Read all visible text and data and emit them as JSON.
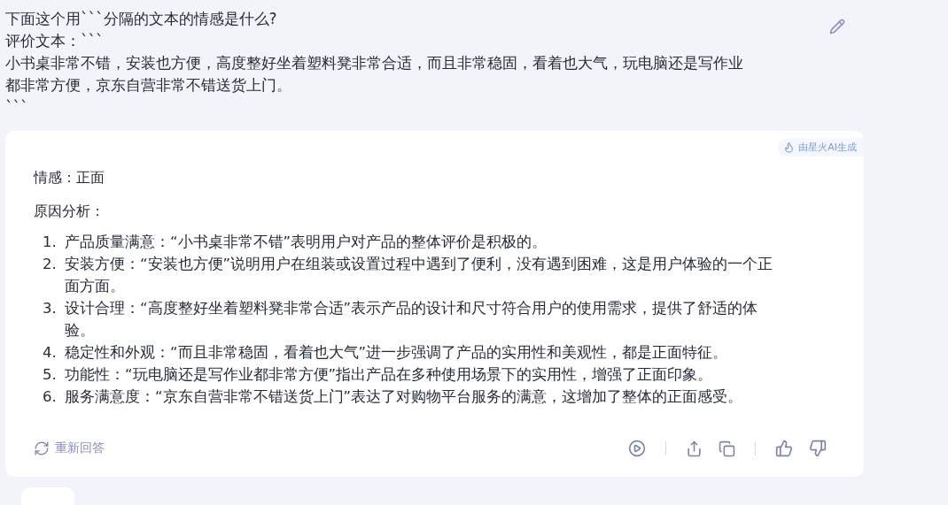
{
  "question": {
    "lines": [
      "下面这个用```分隔的文本的情感是什么?",
      "评价文本：```",
      "小书桌非常不错，安装也方便，高度整好坐着塑料凳非常合适，而且非常稳固，看着也大气，玩电脑还是写作业",
      "都非常方便，京东自营非常不错送货上门。",
      "```"
    ]
  },
  "answer": {
    "badge": "由星火AI生成",
    "sentiment": "情感：正面",
    "analysis_title": "原因分析：",
    "reasons": [
      {
        "number": "1.",
        "lines": [
          "产品质量满意：“小书桌非常不错”表明用户对产品的整体评价是积极的。"
        ]
      },
      {
        "number": "2.",
        "lines": [
          "安装方便：“安装也方便”说明用户在组装或设置过程中遇到了便利，没有遇到困难，这是用户体验的一个正",
          "面方面。"
        ]
      },
      {
        "number": "3.",
        "lines": [
          "设计合理：“高度整好坐着塑料凳非常合适”表示产品的设计和尺寸符合用户的使用需求，提供了舒适的体",
          "验。"
        ]
      },
      {
        "number": "4.",
        "lines": [
          "稳定性和外观：“而且非常稳固，看着也大气”进一步强调了产品的实用性和美观性，都是正面特征。"
        ]
      },
      {
        "number": "5.",
        "lines": [
          "功能性：“玩电脑还是写作业都非常方便”指出产品在多种使用场景下的实用性，增强了正面印象。"
        ]
      },
      {
        "number": "6.",
        "lines": [
          "服务满意度：“京东自营非常不错送货上门”表达了对购物平台服务的满意，这增加了整体的正面感受。"
        ]
      }
    ],
    "regenerate": "重新回答"
  }
}
